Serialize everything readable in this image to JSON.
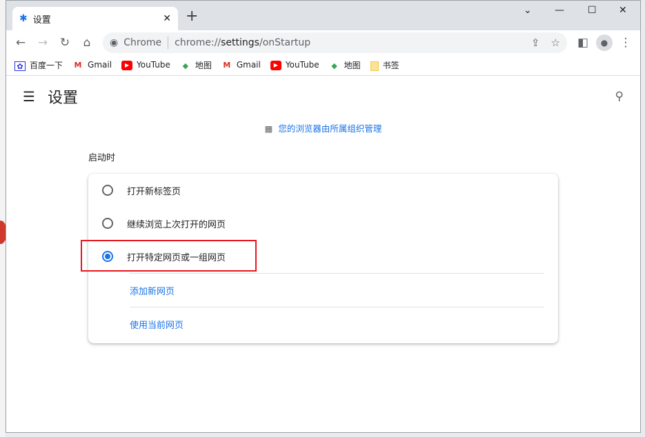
{
  "tab": {
    "title": "设置",
    "icon": "gear-icon"
  },
  "omnibox": {
    "site": "Chrome",
    "url_prefix": "chrome://",
    "url_host": "settings",
    "url_path": "/onStartup"
  },
  "bookmarks": [
    {
      "label": "百度一下",
      "icon": "baidu-icon"
    },
    {
      "label": "Gmail",
      "icon": "gmail-icon"
    },
    {
      "label": "YouTube",
      "icon": "youtube-icon"
    },
    {
      "label": "地图",
      "icon": "maps-icon"
    },
    {
      "label": "Gmail",
      "icon": "gmail-icon"
    },
    {
      "label": "YouTube",
      "icon": "youtube-icon"
    },
    {
      "label": "地图",
      "icon": "maps-icon"
    },
    {
      "label": "书签",
      "icon": "folder-icon"
    }
  ],
  "header": {
    "title": "设置"
  },
  "managed": "您的浏览器由所属组织管理",
  "section": "启动时",
  "options": [
    {
      "label": "打开新标签页",
      "checked": false
    },
    {
      "label": "继续浏览上次打开的网页",
      "checked": false
    },
    {
      "label": "打开特定网页或一组网页",
      "checked": true
    }
  ],
  "links": {
    "add": "添加新网页",
    "current": "使用当前网页"
  },
  "colors": {
    "accent": "#1a73e8",
    "highlight": "#e8141c"
  }
}
